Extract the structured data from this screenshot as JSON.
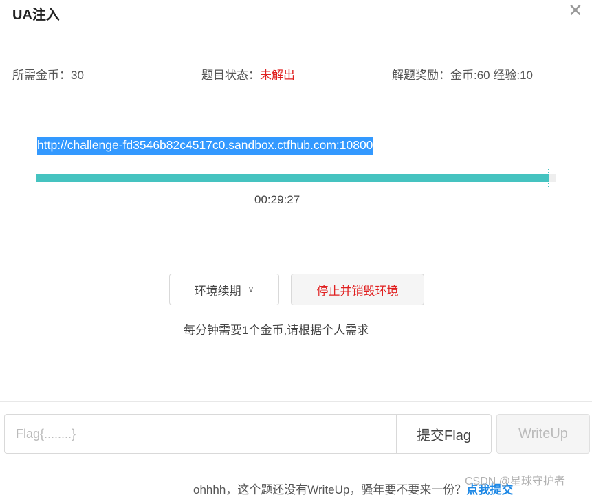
{
  "dialog": {
    "title": "UA注入",
    "close_glyph": "✕"
  },
  "info": {
    "coins_required": "所需金币：30",
    "status_label": "题目状态：",
    "status_value": "未解出",
    "reward": "解题奖励：金币:60 经验:10"
  },
  "challenge": {
    "url": "http://challenge-fd3546b82c4517c0.sandbox.ctfhub.com:10800",
    "progress_fraction": 0.985,
    "timer": "00:29:27"
  },
  "actions": {
    "renew_label": "环境续期",
    "renew_chevron": "∨",
    "stop_label": "停止并销毁环境"
  },
  "notice": "每分钟需要1个金币,请根据个人需求",
  "flag": {
    "placeholder": "Flag{........}",
    "submit_label": "提交Flag",
    "writeup_label": "WriteUp"
  },
  "bottom": {
    "note_text": "ohhhh，这个题还没有WriteUp，骚年要不要来一份？",
    "submit_link": "点我提交"
  },
  "watermark": "CSDN @星球守护者",
  "colors": {
    "accent": "#45c3c0",
    "danger": "#e02020",
    "link": "#1e88e5",
    "selection": "#3399ff"
  }
}
